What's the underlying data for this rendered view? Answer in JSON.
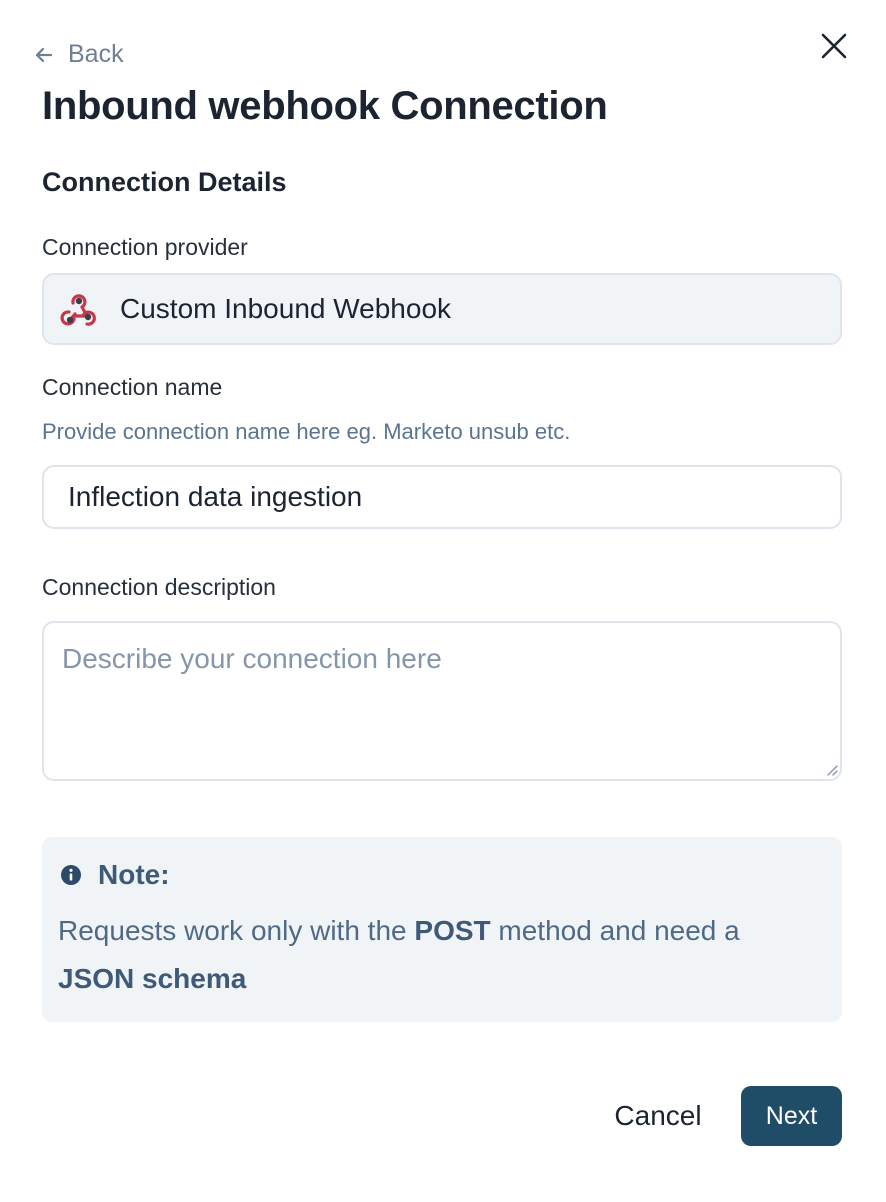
{
  "header": {
    "back_label": "Back",
    "title": "Inbound webhook Connection",
    "back_icon": "arrow-left-icon",
    "close_icon": "close-icon"
  },
  "section": {
    "title": "Connection Details"
  },
  "provider": {
    "label": "Connection provider",
    "value": "Custom Inbound Webhook",
    "icon": "webhook-icon",
    "icon_color": "#c7374a"
  },
  "name_field": {
    "label": "Connection name",
    "help": "Provide connection name here eg. Marketo unsub etc.",
    "value": "Inflection data ingestion"
  },
  "description_field": {
    "label": "Connection description",
    "placeholder": "Describe your connection here",
    "value": ""
  },
  "note": {
    "icon": "info-icon",
    "title": "Note:",
    "text_1": "Requests work only with the ",
    "method": "POST",
    "text_2": " method and need a ",
    "schema": "JSON schema"
  },
  "footer": {
    "cancel_label": "Cancel",
    "next_label": "Next"
  },
  "colors": {
    "primary_button": "#1f4c67",
    "muted_text": "#6f7f95",
    "help_text": "#5b7590",
    "panel_background": "#f1f4f7"
  }
}
